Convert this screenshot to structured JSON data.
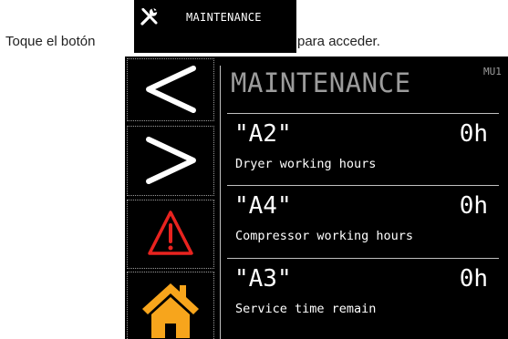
{
  "instruction": {
    "before": "Toque el botón",
    "after": "para acceder."
  },
  "maintenance_button": {
    "label": "MAINTENANCE",
    "icon": "wrench-screwdriver-icon"
  },
  "screen": {
    "title": "MAINTENANCE",
    "code": "MU1",
    "rows": [
      {
        "code": "\"A2\"",
        "value": "0h",
        "label": "Dryer working hours"
      },
      {
        "code": "\"A4\"",
        "value": "0h",
        "label": "Compressor working hours"
      },
      {
        "code": "\"A3\"",
        "value": "0h",
        "label": "Service time remain"
      }
    ]
  },
  "side_buttons": [
    {
      "icon": "back-arrow-icon"
    },
    {
      "icon": "forward-arrow-icon"
    },
    {
      "icon": "alarm-warning-icon"
    },
    {
      "icon": "home-icon"
    }
  ],
  "colors": {
    "screen_bg": "#000000",
    "title_gray": "#9c9c9c",
    "alarm_red": "#e8231f",
    "home_orange": "#f7a51c"
  }
}
